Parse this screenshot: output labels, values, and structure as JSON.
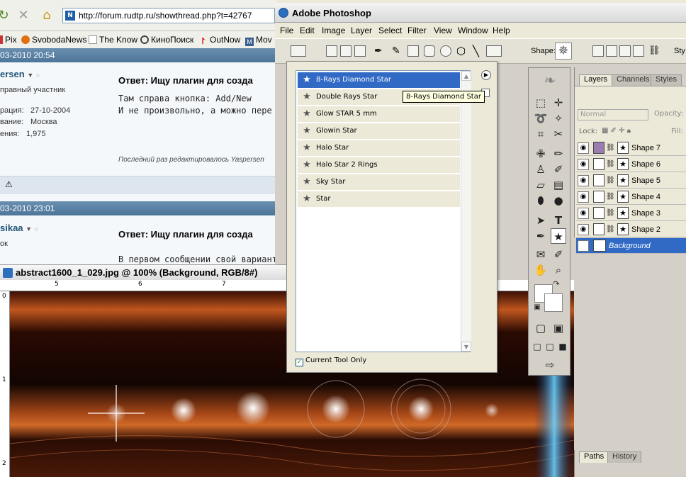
{
  "browser": {
    "url": "http://forum.rudtp.ru/showthread.php?t=42767",
    "bookmarks": [
      "Pix",
      "SvobodaNews",
      "The Know",
      "КиноПоиск",
      "OutNow",
      "Mov"
    ]
  },
  "forum": {
    "post1": {
      "date": "03-2010 20:54",
      "author": "ersen",
      "rank": "правный участник",
      "reg_label": "рация:",
      "reg_value": "27-10-2004",
      "loc_label": "вание:",
      "loc_value": "Москва",
      "posts_label": "ения:",
      "posts_value": "1,975",
      "title": "Ответ: Ищу плагин для созда",
      "body_line1": "Там справа кнопка: Add/New",
      "body_line2": "И не произвольно, а можно пере",
      "edited": "Последний раз редактировалось Yaspersen"
    },
    "post2": {
      "date": "03-2010 23:01",
      "author": "sikaa",
      "rank": "ок",
      "title": "Ответ: Ищу плагин для созда",
      "body_line1": "В первом сообщении свой вариант"
    }
  },
  "photoshop": {
    "title": "Adobe Photoshop",
    "menu": [
      "File",
      "Edit",
      "Image",
      "Layer",
      "Select",
      "Filter",
      "View",
      "Window",
      "Help"
    ],
    "options_shape_label": "Shape:",
    "options_style_label": "Sty",
    "document_title": "abstract1600_1_029.jpg @ 100% (Background, RGB/8#)",
    "ruler_numbers": [
      "5",
      "6",
      "7"
    ],
    "ruler_left_numbers": [
      "0",
      "1",
      "2"
    ],
    "picker": {
      "items": [
        "8-Rays Diamond Star",
        "Double Rays Star",
        "Glow STAR 5 mm",
        "Glowin Star",
        "Halo Star",
        "Halo Star 2 Rings",
        "Sky Star",
        "Star"
      ],
      "selected_index": 0,
      "current_tool_only": "Current Tool Only",
      "tooltip": "8-Rays Diamond Star"
    },
    "layers_panel": {
      "tabs": [
        "Layers",
        "Channels",
        "Styles"
      ],
      "blend_mode": "Normal",
      "opacity_label": "Opacity:",
      "lock_label": "Lock:",
      "fill_label": "Fill:",
      "layers": [
        "Shape 7",
        "Shape 6",
        "Shape 5",
        "Shape 4",
        "Shape 3",
        "Shape 2",
        "Background"
      ],
      "selected_layer": "Background"
    },
    "paths_panel": {
      "tabs": [
        "Paths",
        "History"
      ]
    },
    "colors": {
      "selection": "#316ac5",
      "shape7_thumb": "#9a7cb0"
    }
  }
}
